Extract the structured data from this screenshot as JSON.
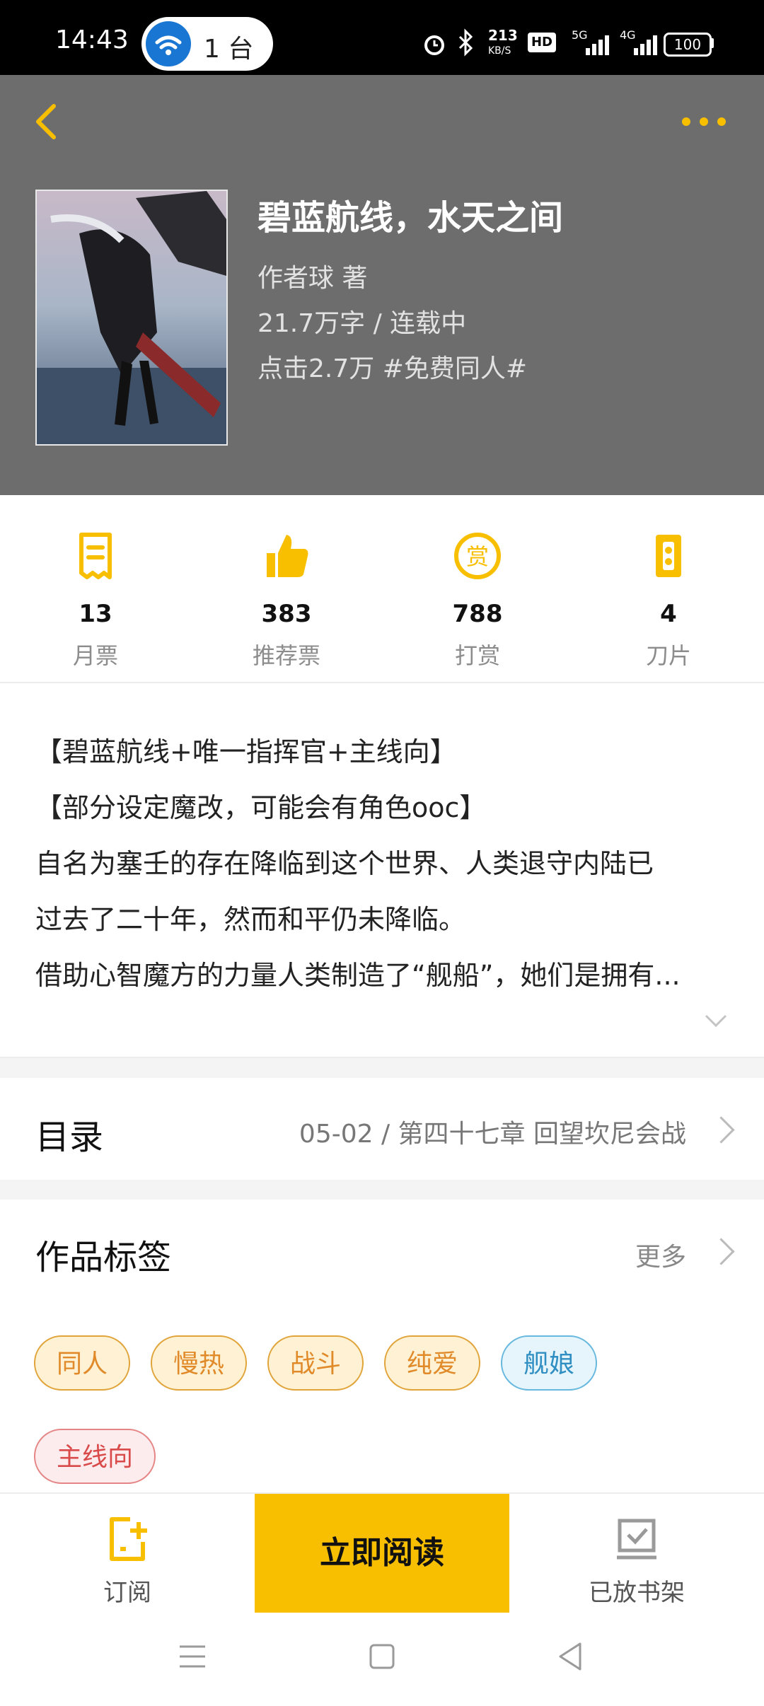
{
  "status_bar": {
    "time": "14:43",
    "hotspot_count": "1 台",
    "net_speed_value": "213",
    "net_speed_unit": "KB/S",
    "hd_label": "HD",
    "net_5g": "5G",
    "net_4g": "4G",
    "battery": "100"
  },
  "book": {
    "title": "碧蓝航线，水天之间",
    "author": "作者球  著",
    "word_status": "21.7万字 / 连载中",
    "clicks_tags": "点击2.7万  #免费同人#"
  },
  "stats": [
    {
      "value": "13",
      "label": "月票",
      "icon": "monthly-ticket-icon"
    },
    {
      "value": "383",
      "label": "推荐票",
      "icon": "thumbs-up-icon"
    },
    {
      "value": "788",
      "label": "打赏",
      "icon": "reward-icon"
    },
    {
      "value": "4",
      "label": "刀片",
      "icon": "blade-icon"
    }
  ],
  "reward_glyph": "赏",
  "description": [
    "【碧蓝航线+唯一指挥官+主线向】",
    "【部分设定魔改，可能会有角色ooc】",
    "自名为塞壬的存在降临到这个世界、人类退守内陆已",
    "过去了二十年，然而和平仍未降临。",
    "借助心智魔方的力量人类制造了“舰船”，她们是拥有..."
  ],
  "toc": {
    "label": "目录",
    "latest": "05-02 / 第四十七章  回望坎尼会战"
  },
  "tags_section": {
    "label": "作品标签",
    "more": "更多",
    "tags": [
      "同人",
      "慢热",
      "战斗",
      "纯爱",
      "舰娘",
      "主线向"
    ]
  },
  "bottom_bar": {
    "subscribe": "订阅",
    "read_now": "立即阅读",
    "on_shelf": "已放书架"
  },
  "colors": {
    "accent": "#f8bf00",
    "header_bg": "#6d6d6d"
  }
}
